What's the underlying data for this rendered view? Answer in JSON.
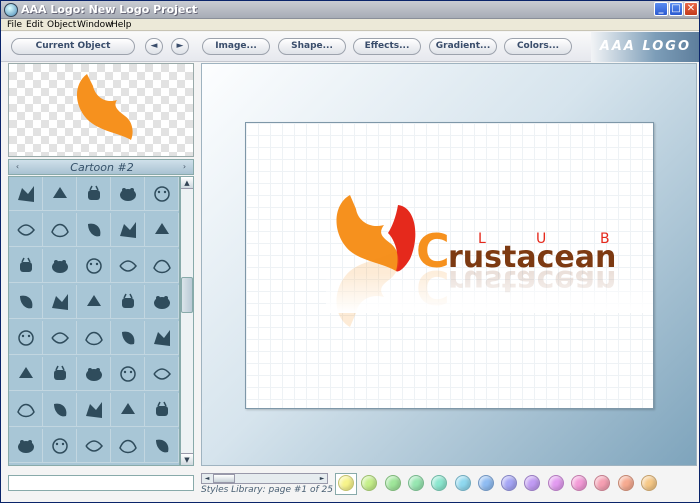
{
  "window": {
    "title": "AAA Logo: New Logo Project",
    "min_glyph": "_",
    "max_glyph": "□",
    "close_glyph": "✕"
  },
  "menu": [
    "File",
    "Edit",
    "Object",
    "Window",
    "Help"
  ],
  "toolbar": {
    "current_object": "Current Object",
    "prev": "◄",
    "next": "►",
    "image": "Image...",
    "shape": "Shape...",
    "effects": "Effects...",
    "gradient": "Gradient...",
    "colors": "Colors...",
    "brand": "AAA LOGO"
  },
  "library": {
    "title": "Cartoon #2",
    "prev": "‹",
    "next": "›",
    "scroll_up": "▲",
    "scroll_down": "▼",
    "pager_text": "Styles Library: page #1 of 25"
  },
  "canvas": {
    "logo_word": "rustacean",
    "logo_initial": "C",
    "logo_sub": [
      "L",
      "U",
      "B"
    ]
  },
  "colors": {
    "orange": "#f6911e",
    "red": "#e5291c",
    "brown": "#7d3a12",
    "icon": "#2f4c5c"
  },
  "swatches": [
    "#f7f48b",
    "#c5ef8a",
    "#9fe69a",
    "#97e6b1",
    "#8be7cf",
    "#8fd8ef",
    "#8fbcf2",
    "#a5a5f5",
    "#c09bf3",
    "#e29bf0",
    "#f39bd7",
    "#f59fb2",
    "#f6aa90",
    "#f6c886"
  ]
}
